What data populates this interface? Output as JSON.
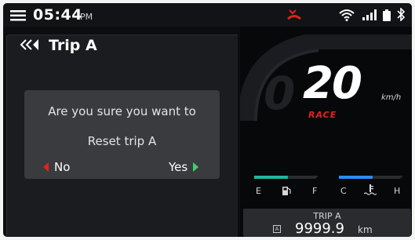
{
  "status_bar": {
    "time": "05:44",
    "ampm": "PM"
  },
  "screen": {
    "title": "Trip A"
  },
  "dialog": {
    "line1": "Are you sure you want to",
    "line2": "Reset trip A",
    "no_label": "No",
    "yes_label": "Yes"
  },
  "speedometer": {
    "speed": "20",
    "unit": "km/h",
    "mode": "RACE"
  },
  "fuel_gauge": {
    "empty_label": "E",
    "full_label": "F",
    "level": 0.55
  },
  "temp_gauge": {
    "cold_label": "C",
    "hot_label": "H",
    "level": 0.55
  },
  "trip_box": {
    "label": "TRIP A",
    "badge": "A",
    "value": "9999.9",
    "unit": "km"
  },
  "colors": {
    "accent_red": "#e2231a",
    "fuel_teal": "#1fb8a0",
    "temp_blue": "#2a8cff",
    "confirm_green": "#3bd16f"
  }
}
